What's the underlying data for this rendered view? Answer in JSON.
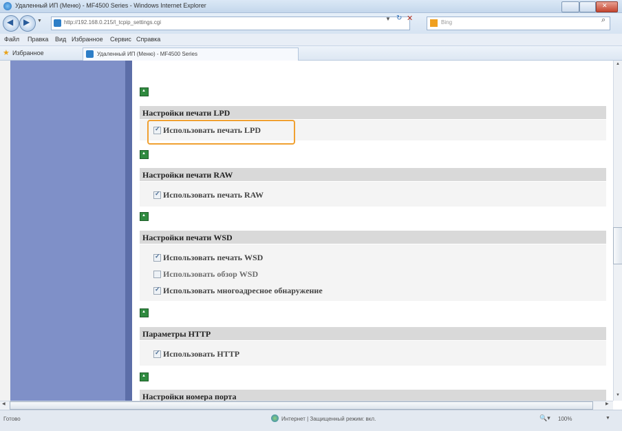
{
  "window": {
    "title": "Удаленный ИП (Меню) - MF4500 Series - Windows Internet Explorer",
    "controls": {
      "minimize": "",
      "maximize": "",
      "close": ""
    }
  },
  "address": {
    "url": "http://192.168.0.215/l_tcpip_settings.cgi",
    "search_placeholder": "Bing"
  },
  "menu": {
    "items": [
      "Файл",
      "Правка",
      "Вид",
      "Избранное",
      "Сервис",
      "Справка"
    ]
  },
  "favorites": {
    "label": "Избранное",
    "tab_title": "Удаленный ИП (Меню) - MF4500 Series"
  },
  "sections": [
    {
      "title": "Настройки печати LPD",
      "options": [
        {
          "label": "Использовать печать LPD",
          "checked": true
        }
      ]
    },
    {
      "title": "Настройки печати RAW",
      "options": [
        {
          "label": "Использовать печать RAW",
          "checked": true
        }
      ]
    },
    {
      "title": "Настройки печати WSD",
      "options": [
        {
          "label": "Использовать печать WSD",
          "checked": true
        },
        {
          "label": "Использовать обзор WSD",
          "checked": false
        },
        {
          "label": "Использовать многоадресное обнаружение",
          "checked": true
        }
      ]
    },
    {
      "title": "Параметры HTTP",
      "options": [
        {
          "label": "Использовать HTTP",
          "checked": true
        }
      ]
    },
    {
      "title": "Настройки номера порта",
      "options": []
    }
  ],
  "status": {
    "left": "Готово",
    "zone": "Интернет | Защищенный режим: вкл.",
    "zoom": "100%"
  },
  "colors": {
    "highlight": "#f0a030",
    "left_panel": "#7f90c8",
    "section_header": "#d9d9d9"
  }
}
